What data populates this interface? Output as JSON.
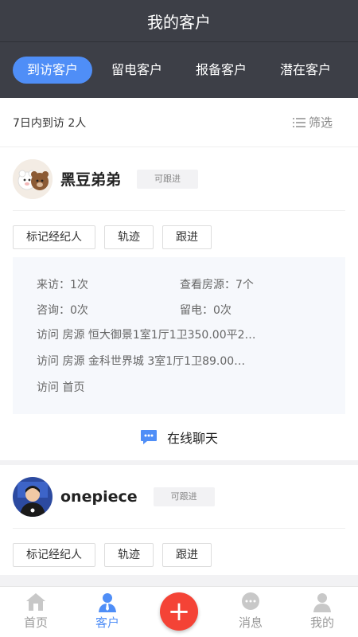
{
  "title": "我的客户",
  "tabs": [
    {
      "label": "到访客户"
    },
    {
      "label": "留电客户"
    },
    {
      "label": "报备客户"
    },
    {
      "label": "潜在客户"
    }
  ],
  "summary": {
    "text": "7日内到访 2人",
    "filter_label": "筛选"
  },
  "customers": [
    {
      "name": "黑豆弟弟",
      "status": "可跟进",
      "actions": [
        "标记经纪人",
        "轨迹",
        "跟进"
      ],
      "stats": {
        "visits": "来访：1次",
        "views": "查看房源：7个",
        "consults": "咨询：0次",
        "calls": "留电：0次"
      },
      "visit_log": [
        "访问 房源 恒大御景1室1厅1卫350.00平2…",
        "访问 房源 金科世界城 3室1厅1卫89.00…",
        "访问 首页"
      ],
      "chat_label": "在线聊天"
    },
    {
      "name": "onepiece",
      "status": "可跟进",
      "actions": [
        "标记经纪人",
        "轨迹",
        "跟进"
      ]
    }
  ],
  "nav": {
    "home": "首页",
    "customers": "客户",
    "messages": "消息",
    "mine": "我的",
    "add": "+"
  },
  "colors": {
    "header_bg": "#3d3f47",
    "accent": "#4f8ef7",
    "fab": "#f44336"
  }
}
